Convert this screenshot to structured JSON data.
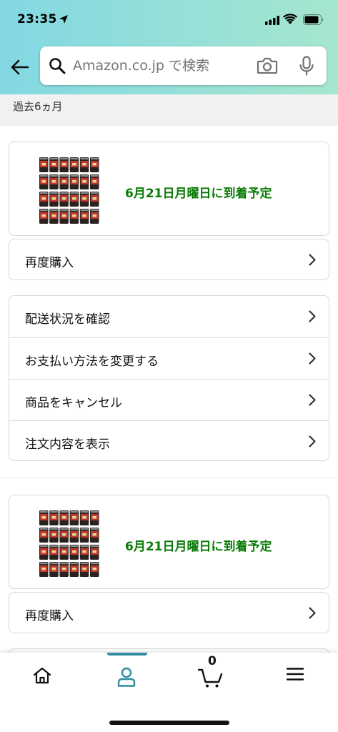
{
  "status_bar": {
    "time": "23:35"
  },
  "search": {
    "placeholder": "Amazon.co.jp で検索"
  },
  "filter": {
    "period_label": "過去6ヵ月"
  },
  "orders": [
    {
      "delivery_text": "6月21日月曜日に到着予定",
      "buy_again_label": "再度購入"
    },
    {
      "delivery_text": "6月21日月曜日に到着予定",
      "buy_again_label": "再度購入"
    }
  ],
  "order_actions": [
    {
      "label": "配送状況を確認"
    },
    {
      "label": "お支払い方法を変更する"
    },
    {
      "label": "商品をキャンセル"
    },
    {
      "label": "注文内容を表示"
    }
  ],
  "tabbar": {
    "active_tab": "account",
    "cart_count": "0",
    "accent_color": "#2f8ea0"
  },
  "colors": {
    "delivery_text": "#0a7b06"
  }
}
